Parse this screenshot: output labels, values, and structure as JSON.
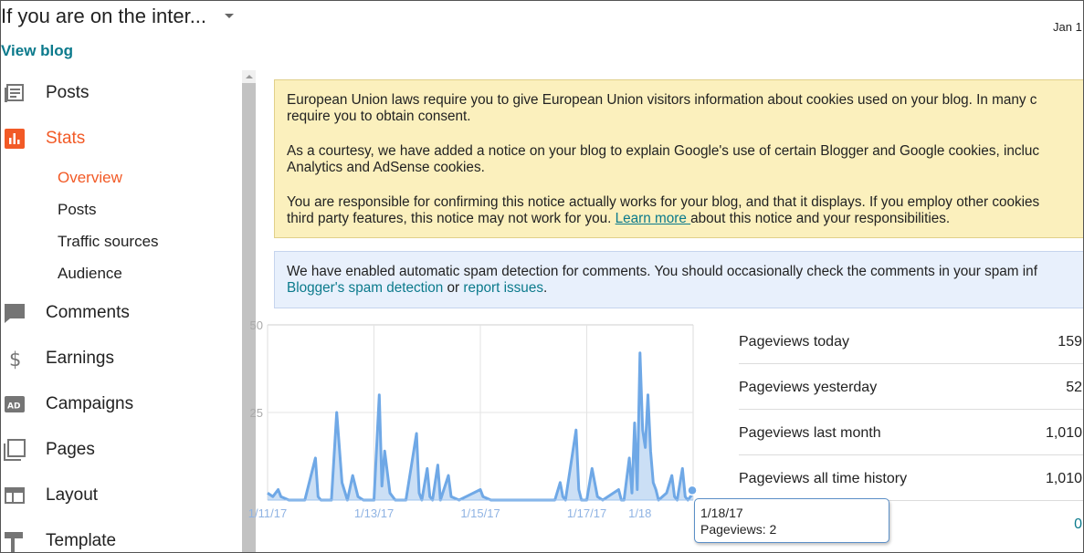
{
  "header": {
    "blog_title": "If you are on the inter...",
    "view_blog": "View blog",
    "date": "Jan 1"
  },
  "sidebar": {
    "items": [
      {
        "label": "Posts",
        "icon": "posts-icon"
      },
      {
        "label": "Stats",
        "icon": "stats-icon",
        "active": true
      },
      {
        "label": "Comments",
        "icon": "comments-icon"
      },
      {
        "label": "Earnings",
        "icon": "dollar-icon"
      },
      {
        "label": "Campaigns",
        "icon": "ad-icon"
      },
      {
        "label": "Pages",
        "icon": "pages-icon"
      },
      {
        "label": "Layout",
        "icon": "layout-icon"
      },
      {
        "label": "Template",
        "icon": "template-icon"
      }
    ],
    "stats_subitems": [
      "Overview",
      "Posts",
      "Traffic sources",
      "Audience"
    ]
  },
  "colors": {
    "accent": "#f25a26",
    "link": "#0b7a8c",
    "chart_line": "#6fa8e6",
    "chart_fill": "#b9d4f2",
    "cookie_notice_bg": "#fbf0bd",
    "spam_notice_bg": "#e8f0fc"
  },
  "cookie_notice": {
    "p1_line1": "European Union laws require you to give European Union visitors information about cookies used on your blog. In many c",
    "p1_line2": "require you to obtain consent.",
    "p2_line1": "As a courtesy, we have added a notice on your blog to explain Google's use of certain Blogger and Google cookies, incluc",
    "p2_line2": "Analytics and AdSense cookies.",
    "p3_line1": "You are responsible for confirming this notice actually works for your blog, and that it displays. If you employ other cookies",
    "p3_line2_before": "third party features, this notice may not work for you. ",
    "learn_more": "Learn more ",
    "p3_line2_after": "about this notice and your responsibilities."
  },
  "spam_notice": {
    "line1": "We have enabled automatic spam detection for comments. You should occasionally check the comments in your spam inf",
    "link1": "Blogger's spam detection",
    "or": " or ",
    "link2": "report issues",
    "end": "."
  },
  "chart_data": {
    "type": "area",
    "title": "",
    "xlabel": "",
    "ylabel": "",
    "ylim": [
      0,
      50
    ],
    "yticks": [
      25,
      50
    ],
    "xtick_labels": [
      "1/11/17",
      "1/13/17",
      "1/15/17",
      "1/17/17",
      "1/18"
    ],
    "xtick_days": [
      0,
      2,
      4,
      6,
      7
    ],
    "x_days_range": [
      0,
      8
    ],
    "series": [
      {
        "values": [
          [
            0.0,
            2
          ],
          [
            0.1,
            1
          ],
          [
            0.2,
            3
          ],
          [
            0.25,
            1
          ],
          [
            0.4,
            0
          ],
          [
            0.5,
            0
          ],
          [
            0.7,
            0
          ],
          [
            0.9,
            12
          ],
          [
            0.95,
            1
          ],
          [
            1.0,
            0
          ],
          [
            1.2,
            0
          ],
          [
            1.3,
            25
          ],
          [
            1.4,
            5
          ],
          [
            1.5,
            0
          ],
          [
            1.6,
            7
          ],
          [
            1.7,
            1
          ],
          [
            1.8,
            0
          ],
          [
            2.0,
            0
          ],
          [
            2.1,
            30
          ],
          [
            2.15,
            4
          ],
          [
            2.2,
            14
          ],
          [
            2.3,
            2
          ],
          [
            2.4,
            0
          ],
          [
            2.6,
            0
          ],
          [
            2.8,
            19
          ],
          [
            2.85,
            2
          ],
          [
            2.9,
            0
          ],
          [
            3.0,
            9
          ],
          [
            3.05,
            1
          ],
          [
            3.1,
            0
          ],
          [
            3.2,
            10
          ],
          [
            3.25,
            0
          ],
          [
            3.4,
            7
          ],
          [
            3.45,
            1
          ],
          [
            3.6,
            0
          ],
          [
            4.0,
            3
          ],
          [
            4.05,
            1
          ],
          [
            4.2,
            0
          ],
          [
            5.0,
            0
          ],
          [
            5.4,
            0
          ],
          [
            5.5,
            5
          ],
          [
            5.55,
            1
          ],
          [
            5.6,
            0
          ],
          [
            5.8,
            20
          ],
          [
            5.85,
            3
          ],
          [
            5.9,
            0
          ],
          [
            6.0,
            0
          ],
          [
            6.1,
            9
          ],
          [
            6.2,
            1
          ],
          [
            6.3,
            0
          ],
          [
            6.6,
            3
          ],
          [
            6.65,
            0
          ],
          [
            6.7,
            0
          ],
          [
            6.8,
            12
          ],
          [
            6.85,
            2
          ],
          [
            6.9,
            22
          ],
          [
            6.95,
            3
          ],
          [
            7.0,
            42
          ],
          [
            7.05,
            20
          ],
          [
            7.1,
            15
          ],
          [
            7.15,
            30
          ],
          [
            7.2,
            14
          ],
          [
            7.25,
            5
          ],
          [
            7.3,
            3
          ],
          [
            7.35,
            0
          ],
          [
            7.5,
            2
          ],
          [
            7.6,
            7
          ],
          [
            7.65,
            1
          ],
          [
            7.7,
            0
          ],
          [
            7.8,
            9
          ],
          [
            7.85,
            1
          ],
          [
            7.9,
            0
          ],
          [
            8.0,
            2
          ]
        ]
      }
    ],
    "grid": true
  },
  "stats": {
    "rows": [
      {
        "label": "Pageviews today",
        "value": "159"
      },
      {
        "label": "Pageviews yesterday",
        "value": "52"
      },
      {
        "label": "Pageviews last month",
        "value": "1,010"
      },
      {
        "label": "Pageviews all time history",
        "value": "1,010"
      },
      {
        "label": "",
        "value": "0",
        "link": true
      }
    ]
  },
  "tooltip": {
    "date": "1/18/17",
    "pageviews": "Pageviews: 2"
  }
}
